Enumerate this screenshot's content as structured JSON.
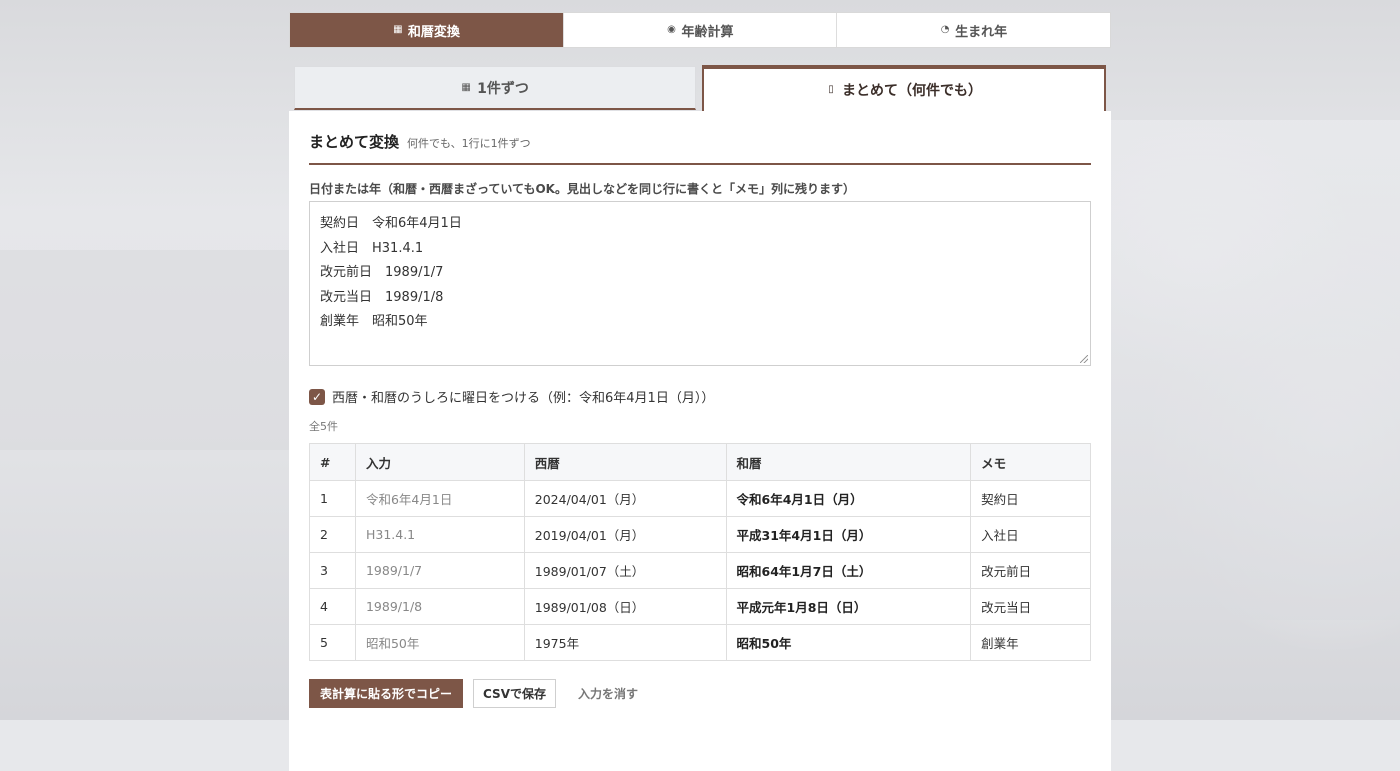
{
  "modes": [
    {
      "icon": "calendar-icon",
      "label": "和暦変換",
      "active": true
    },
    {
      "icon": "birthday-cake-icon",
      "label": "年齢計算",
      "active": false
    },
    {
      "icon": "clock-icon",
      "label": "生まれ年",
      "active": false
    }
  ],
  "subtabs": {
    "single": {
      "icon": "calendar-icon",
      "label": "1件ずつ"
    },
    "batch": {
      "icon": "clipboard-icon",
      "label": "まとめて（何件でも）"
    }
  },
  "section": {
    "title": "まとめて変換",
    "subtitle": "何件でも、1行に1件ずつ"
  },
  "input": {
    "label": "日付または年（和暦・西暦まざっていてもOK。見出しなどを同じ行に書くと「メモ」列に残ります）",
    "lines": [
      "契約日　令和6年4月1日",
      "入社日　H31.4.1",
      "改元前日　1989/1/7",
      "改元当日　1989/1/8",
      "創業年　昭和50年"
    ]
  },
  "weekday_option": {
    "checked": true,
    "label": "西暦・和暦のうしろに曜日をつける（例：令和6年4月1日（月））"
  },
  "count": "全5件",
  "table": {
    "headers": [
      "#",
      "入力",
      "西暦",
      "和暦",
      "メモ"
    ],
    "rows": [
      [
        "1",
        "令和6年4月1日",
        "2024/04/01（月）",
        "令和6年4月1日（月）",
        "契約日"
      ],
      [
        "2",
        "H31.4.1",
        "2019/04/01（月）",
        "平成31年4月1日（月）",
        "入社日"
      ],
      [
        "3",
        "1989/1/7",
        "1989/01/07（土）",
        "昭和64年1月7日（土）",
        "改元前日"
      ],
      [
        "4",
        "1989/1/8",
        "1989/01/08（日）",
        "平成元年1月8日（日）",
        "改元当日"
      ],
      [
        "5",
        "昭和50年",
        "1975年",
        "昭和50年",
        "創業年"
      ]
    ]
  },
  "actions": {
    "copy": "表計算に貼る形でコピー",
    "csv": "CSVで保存",
    "clear": "入力を消す"
  },
  "colors": {
    "accent": "#7d5647"
  }
}
